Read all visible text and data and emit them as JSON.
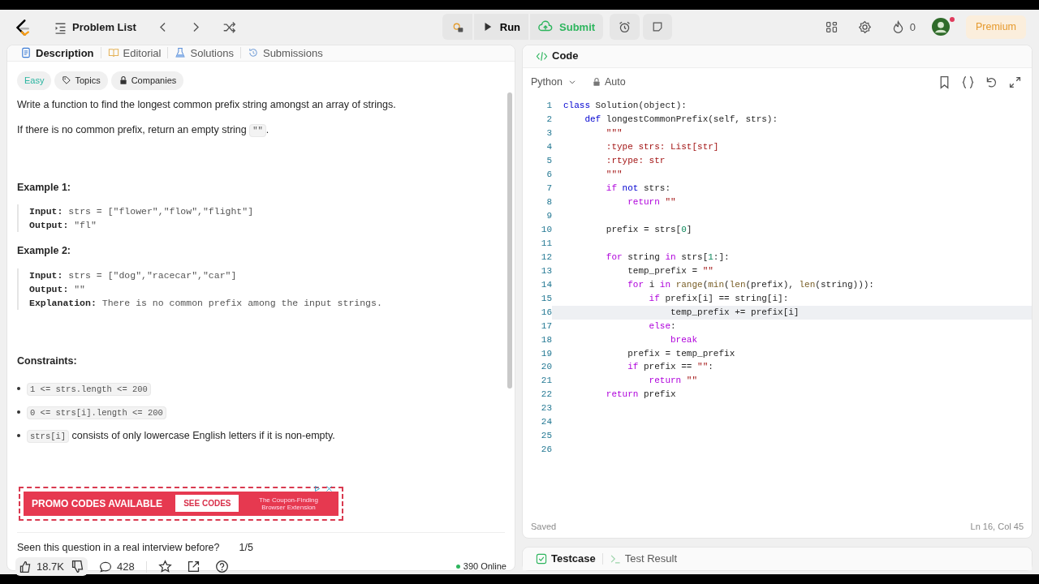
{
  "topbar": {
    "problem_list": "Problem List",
    "run": "Run",
    "submit": "Submit",
    "streak": "0",
    "premium": "Premium",
    "avatar_notification": true
  },
  "description_tabs": [
    {
      "label": "Description",
      "selected": true
    },
    {
      "label": "Editorial",
      "selected": false
    },
    {
      "label": "Solutions",
      "selected": false
    },
    {
      "label": "Submissions",
      "selected": false
    }
  ],
  "tags": [
    {
      "label": "Easy",
      "kind": "difficulty"
    },
    {
      "label": "Topics",
      "kind": "tag"
    },
    {
      "label": "Companies",
      "kind": "lock"
    }
  ],
  "paragraphs": [
    [
      {
        "text": "Write a function to find the longest common prefix string amongst an array of strings.",
        "kind": "text"
      }
    ],
    [
      {
        "text": "If there is no common prefix, return an empty string ",
        "kind": "text"
      },
      {
        "text": "\"\"",
        "kind": "code"
      },
      {
        "text": ".",
        "kind": "text"
      }
    ]
  ],
  "examples": [
    {
      "title": "Example 1:",
      "lines": [
        {
          "label": "Input:",
          "value": "strs = [\"flower\",\"flow\",\"flight\"]"
        },
        {
          "label": "Output:",
          "value": "\"fl\""
        }
      ]
    },
    {
      "title": "Example 2:",
      "lines": [
        {
          "label": "Input:",
          "value": "strs = [\"dog\",\"racecar\",\"car\"]"
        },
        {
          "label": "Output:",
          "value": "\"\""
        },
        {
          "label": "Explanation:",
          "value": "There is no common prefix among the input strings."
        }
      ]
    }
  ],
  "constraints": {
    "title": "Constraints:",
    "items": [
      [
        {
          "text": "1 <= strs.length <= 200",
          "kind": "code"
        }
      ],
      [
        {
          "text": "0 <= strs[i].length <= 200",
          "kind": "code"
        }
      ],
      [
        {
          "text": "strs[i]",
          "kind": "code"
        },
        {
          "text": " consists of only lowercase English letters if it is non-empty.",
          "kind": "text"
        }
      ]
    ]
  },
  "ad": {
    "headline": "PROMO CODES AVAILABLE",
    "button": "SEE CODES",
    "tagline": "The Coupon-Finding Browser Extension"
  },
  "interview": {
    "question": "Seen this question in a real interview before?",
    "count": "1/5"
  },
  "footer": {
    "likes": "18.7K",
    "comments": "428",
    "online": "390 Online"
  },
  "editor": {
    "title": "Code",
    "language": "Python",
    "mode": "Auto",
    "status": "Saved",
    "cursor": "Ln 16, Col 45",
    "lines": [
      {
        "number": "1",
        "current": false,
        "tokens": [
          {
            "text": "class",
            "kind": "decl"
          },
          {
            "text": " Solution(object):",
            "kind": "plain"
          }
        ]
      },
      {
        "number": "2",
        "current": false,
        "tokens": [
          {
            "text": "    def",
            "kind": "decl"
          },
          {
            "text": " longestCommonPrefix(self, strs):",
            "kind": "plain"
          }
        ]
      },
      {
        "number": "3",
        "current": false,
        "tokens": [
          {
            "text": "        \"\"\"",
            "kind": "string"
          }
        ]
      },
      {
        "number": "4",
        "current": false,
        "tokens": [
          {
            "text": "        :type strs: List[str]",
            "kind": "string"
          }
        ]
      },
      {
        "number": "5",
        "current": false,
        "tokens": [
          {
            "text": "        :rtype: str",
            "kind": "string"
          }
        ]
      },
      {
        "number": "6",
        "current": false,
        "tokens": [
          {
            "text": "        \"\"\"",
            "kind": "string"
          }
        ]
      },
      {
        "number": "7",
        "current": false,
        "tokens": [
          {
            "text": "        if",
            "kind": "keyword"
          },
          {
            "text": " not",
            "kind": "decl"
          },
          {
            "text": " strs:",
            "kind": "plain"
          }
        ]
      },
      {
        "number": "8",
        "current": false,
        "tokens": [
          {
            "text": "            return",
            "kind": "keyword"
          },
          {
            "text": " \"\"",
            "kind": "string"
          }
        ]
      },
      {
        "number": "9",
        "current": false
      },
      {
        "number": "10",
        "current": false,
        "tokens": [
          {
            "text": "        prefix = strs[",
            "kind": "plain"
          },
          {
            "text": "0",
            "kind": "number"
          },
          {
            "text": "]",
            "kind": "plain"
          }
        ]
      },
      {
        "number": "11",
        "current": false
      },
      {
        "number": "12",
        "current": false,
        "tokens": [
          {
            "text": "        for",
            "kind": "keyword"
          },
          {
            "text": " string ",
            "kind": "plain"
          },
          {
            "text": "in",
            "kind": "keyword"
          },
          {
            "text": " strs[",
            "kind": "plain"
          },
          {
            "text": "1",
            "kind": "number"
          },
          {
            "text": ":]:",
            "kind": "plain"
          }
        ]
      },
      {
        "number": "13",
        "current": false,
        "tokens": [
          {
            "text": "            temp_prefix = ",
            "kind": "plain"
          },
          {
            "text": "\"\"",
            "kind": "string"
          }
        ]
      },
      {
        "number": "14",
        "current": false,
        "tokens": [
          {
            "text": "            for",
            "kind": "keyword"
          },
          {
            "text": " i ",
            "kind": "plain"
          },
          {
            "text": "in",
            "kind": "keyword"
          },
          {
            "text": " range",
            "kind": "builtin"
          },
          {
            "text": "(",
            "kind": "plain"
          },
          {
            "text": "min",
            "kind": "builtin"
          },
          {
            "text": "(",
            "kind": "plain"
          },
          {
            "text": "len",
            "kind": "builtin"
          },
          {
            "text": "(prefix), ",
            "kind": "plain"
          },
          {
            "text": "len",
            "kind": "builtin"
          },
          {
            "text": "(string))):",
            "kind": "plain"
          }
        ]
      },
      {
        "number": "15",
        "current": false,
        "tokens": [
          {
            "text": "                if",
            "kind": "keyword"
          },
          {
            "text": " prefix[i] == string[i]:",
            "kind": "plain"
          }
        ]
      },
      {
        "number": "16",
        "current": true,
        "tokens": [
          {
            "text": "                    temp_prefix += prefix[i]",
            "kind": "plain"
          }
        ]
      },
      {
        "number": "17",
        "current": false,
        "tokens": [
          {
            "text": "                else",
            "kind": "keyword"
          },
          {
            "text": ":",
            "kind": "plain"
          }
        ]
      },
      {
        "number": "18",
        "current": false,
        "tokens": [
          {
            "text": "                    break",
            "kind": "keyword"
          }
        ]
      },
      {
        "number": "19",
        "current": false,
        "tokens": [
          {
            "text": "            prefix = temp_prefix",
            "kind": "plain"
          }
        ]
      },
      {
        "number": "20",
        "current": false,
        "tokens": [
          {
            "text": "            if",
            "kind": "keyword"
          },
          {
            "text": " prefix == ",
            "kind": "plain"
          },
          {
            "text": "\"\"",
            "kind": "string"
          },
          {
            "text": ":",
            "kind": "plain"
          }
        ]
      },
      {
        "number": "21",
        "current": false,
        "tokens": [
          {
            "text": "                return",
            "kind": "keyword"
          },
          {
            "text": " \"\"",
            "kind": "string"
          }
        ]
      },
      {
        "number": "22",
        "current": false,
        "tokens": [
          {
            "text": "        return",
            "kind": "keyword"
          },
          {
            "text": " prefix",
            "kind": "plain"
          }
        ]
      },
      {
        "number": "23",
        "current": false
      },
      {
        "number": "24",
        "current": false
      },
      {
        "number": "25",
        "current": false
      },
      {
        "number": "26",
        "current": false
      }
    ]
  },
  "bottom_tabs": [
    {
      "label": "Testcase",
      "selected": true
    },
    {
      "label": "Test Result",
      "selected": false
    }
  ]
}
